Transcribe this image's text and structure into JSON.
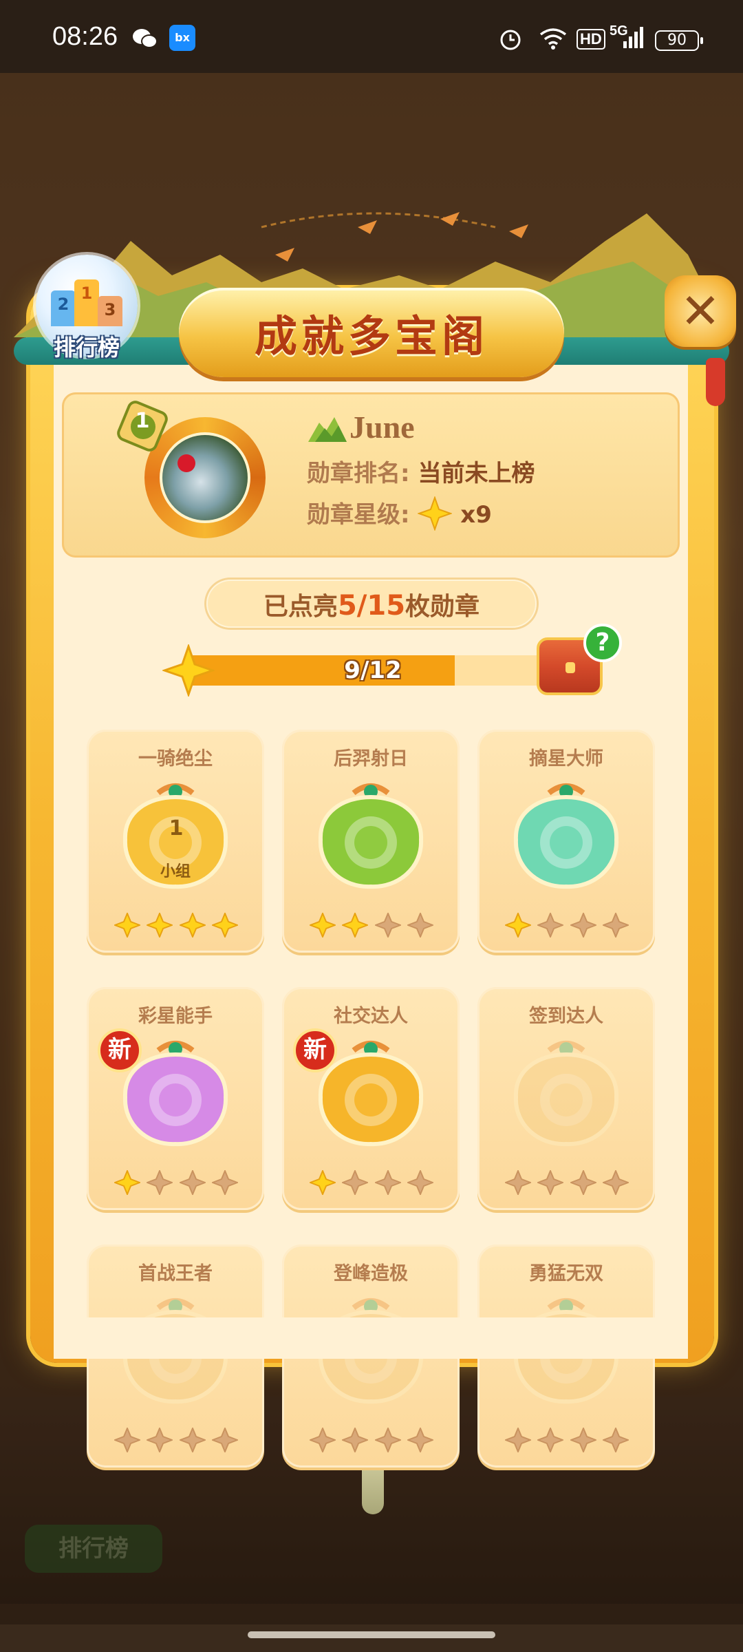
{
  "status_bar": {
    "time": "08:26",
    "network": "5G",
    "hd": "HD",
    "battery": "90"
  },
  "header": {
    "title": "成就多宝阁",
    "ranking_label": "排行榜",
    "ranking_numbers": [
      "2",
      "1",
      "3"
    ],
    "close_icon": "close-icon"
  },
  "profile": {
    "level": "1",
    "name": "June",
    "rank_label": "勋章排名:",
    "rank_value": "当前未上榜",
    "star_label": "勋章星级:",
    "star_count": "x9"
  },
  "medal_summary": {
    "prefix": "已点亮",
    "lit": "5/15",
    "suffix": "枚勋章"
  },
  "progress": {
    "text": "9/12",
    "current": 9,
    "total": 12,
    "help": "?"
  },
  "new_badge": "新",
  "medals": [
    {
      "name": "一骑绝尘",
      "stars": 4,
      "color": "#f7c23a",
      "is_new": false,
      "locked": false,
      "inner": "1",
      "sub": "小组"
    },
    {
      "name": "后羿射日",
      "stars": 2,
      "color": "#8cc93a",
      "is_new": false,
      "locked": false
    },
    {
      "name": "摘星大师",
      "stars": 1,
      "color": "#6fd8b2",
      "is_new": false,
      "locked": false
    },
    {
      "name": "彩星能手",
      "stars": 1,
      "color": "#d68ae6",
      "is_new": true,
      "locked": false
    },
    {
      "name": "社交达人",
      "stars": 1,
      "color": "#f6b52a",
      "is_new": true,
      "locked": false
    },
    {
      "name": "签到达人",
      "stars": 0,
      "color": "#f3c877",
      "is_new": false,
      "locked": true
    },
    {
      "name": "首战王者",
      "stars": 0,
      "color": "#f3c877",
      "is_new": false,
      "locked": true
    },
    {
      "name": "登峰造极",
      "stars": 0,
      "color": "#f3c877",
      "is_new": false,
      "locked": true
    },
    {
      "name": "勇猛无双",
      "stars": 0,
      "color": "#f3c877",
      "is_new": false,
      "locked": true
    }
  ],
  "background": {
    "button_label": "排行榜"
  }
}
